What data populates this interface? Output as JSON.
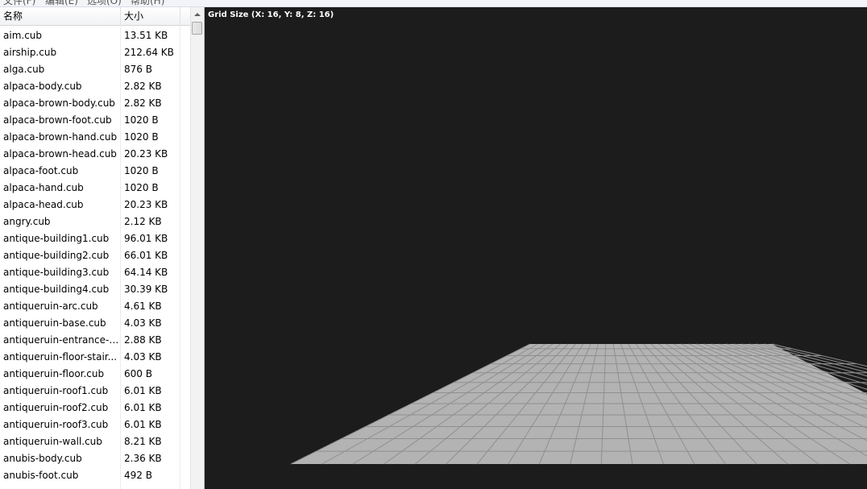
{
  "menu": [
    "文件(F)",
    "编辑(E)",
    "选项(O)",
    "帮助(H)"
  ],
  "file_list": {
    "headers": {
      "name": "名称",
      "size": "大小"
    },
    "rows": [
      {
        "name": "aim.cub",
        "size": "13.51 KB"
      },
      {
        "name": "airship.cub",
        "size": "212.64 KB"
      },
      {
        "name": "alga.cub",
        "size": "876 B"
      },
      {
        "name": "alpaca-body.cub",
        "size": "2.82 KB"
      },
      {
        "name": "alpaca-brown-body.cub",
        "size": "2.82 KB"
      },
      {
        "name": "alpaca-brown-foot.cub",
        "size": "1020 B"
      },
      {
        "name": "alpaca-brown-hand.cub",
        "size": "1020 B"
      },
      {
        "name": "alpaca-brown-head.cub",
        "size": "20.23 KB"
      },
      {
        "name": "alpaca-foot.cub",
        "size": "1020 B"
      },
      {
        "name": "alpaca-hand.cub",
        "size": "1020 B"
      },
      {
        "name": "alpaca-head.cub",
        "size": "20.23 KB"
      },
      {
        "name": "angry.cub",
        "size": "2.12 KB"
      },
      {
        "name": "antique-building1.cub",
        "size": "96.01 KB"
      },
      {
        "name": "antique-building2.cub",
        "size": "66.01 KB"
      },
      {
        "name": "antique-building3.cub",
        "size": "64.14 KB"
      },
      {
        "name": "antique-building4.cub",
        "size": "30.39 KB"
      },
      {
        "name": "antiqueruin-arc.cub",
        "size": "4.61 KB"
      },
      {
        "name": "antiqueruin-base.cub",
        "size": "4.03 KB"
      },
      {
        "name": "antiqueruin-entrance-s...",
        "size": "2.88 KB"
      },
      {
        "name": "antiqueruin-floor-stair...",
        "size": "4.03 KB"
      },
      {
        "name": "antiqueruin-floor.cub",
        "size": "600 B"
      },
      {
        "name": "antiqueruin-roof1.cub",
        "size": "6.01 KB"
      },
      {
        "name": "antiqueruin-roof2.cub",
        "size": "6.01 KB"
      },
      {
        "name": "antiqueruin-roof3.cub",
        "size": "6.01 KB"
      },
      {
        "name": "antiqueruin-wall.cub",
        "size": "8.21 KB"
      },
      {
        "name": "anubis-body.cub",
        "size": "2.36 KB"
      },
      {
        "name": "anubis-foot.cub",
        "size": "492 B"
      }
    ]
  },
  "viewport": {
    "grid_label": "Grid Size (X: 16, Y: 8, Z: 16)",
    "grid_size": {
      "x": 16,
      "y": 8,
      "z": 16
    },
    "background_color": "#1c1c1c",
    "floor_color": "#b3b3b3",
    "floor_line_color": "#8f8f8f"
  }
}
